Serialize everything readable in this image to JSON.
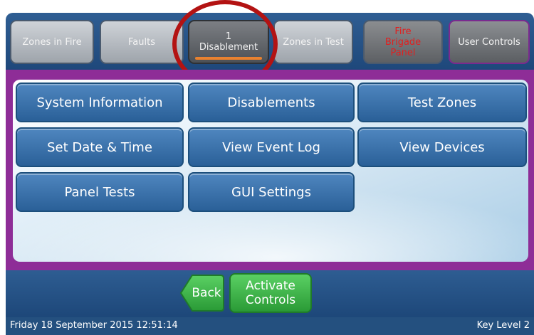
{
  "tabs": [
    {
      "id": "zones_in_fire",
      "label": "Zones in Fire"
    },
    {
      "id": "faults",
      "label": "Faults"
    },
    {
      "id": "disablement",
      "count": "1",
      "label": "Disablement"
    },
    {
      "id": "zones_in_test",
      "label": "Zones in Test"
    },
    {
      "id": "fire_brigade_panel",
      "label_lines": [
        "Fire",
        "Brigade",
        "Panel"
      ]
    },
    {
      "id": "user_controls",
      "label": "User Controls"
    }
  ],
  "menu": {
    "system_information": "System Information",
    "disablements": "Disablements",
    "test_zones": "Test Zones",
    "set_date_time": "Set Date & Time",
    "view_event_log": "View Event Log",
    "view_devices": "View Devices",
    "panel_tests": "Panel Tests",
    "gui_settings": "GUI Settings"
  },
  "footer": {
    "back_label": "Back",
    "activate_lines": [
      "Activate",
      "Controls"
    ]
  },
  "status": {
    "datetime": "Friday 18 September 2015 12:51:14",
    "key_level": "Key Level 2"
  },
  "colors": {
    "fire_text": "#e02020",
    "active_tab_indicator": "#e8812f",
    "panel_frame": "#8e2d97",
    "highlight_circle": "#b31313"
  }
}
